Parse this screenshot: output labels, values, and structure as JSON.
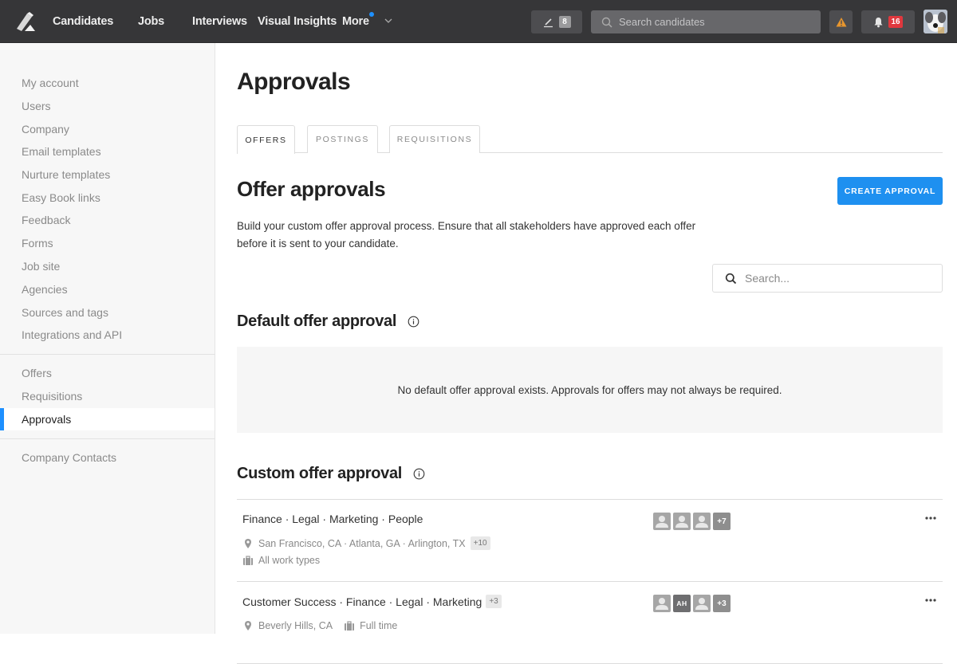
{
  "topnav": {
    "logo": "lever-logo",
    "links": [
      "Candidates",
      "Jobs",
      "Interviews",
      "Visual Insights",
      "More"
    ],
    "more_has_notification": true,
    "tasks_count": "8",
    "search_placeholder": "Search candidates",
    "notifications_count": "16",
    "colors": {
      "bar": "#363638",
      "accent": "#1e90ff",
      "alert": "#e0383e",
      "warning": "#e8962e"
    }
  },
  "sidebar": {
    "group1": [
      "My account",
      "Users",
      "Company",
      "Email templates",
      "Nurture templates",
      "Easy Book links",
      "Feedback",
      "Forms",
      "Job site",
      "Agencies",
      "Sources and tags",
      "Integrations and API"
    ],
    "group2": [
      "Offers",
      "Requisitions",
      "Approvals"
    ],
    "group3": [
      "Company Contacts"
    ],
    "active": "Approvals"
  },
  "main": {
    "title": "Approvals",
    "tabs": [
      {
        "label": "OFFERS",
        "active": true
      },
      {
        "label": "POSTINGS",
        "active": false
      },
      {
        "label": "REQUISITIONS",
        "active": false
      }
    ],
    "section_title": "Offer approvals",
    "create_button": "CREATE APPROVAL",
    "description": "Build your custom offer approval process. Ensure that all stakeholders have approved each offer before it is sent to your candidate.",
    "search_placeholder": "Search...",
    "default_title": "Default offer approval",
    "default_empty": "No default offer approval exists. Approvals for offers may not always be required.",
    "custom_title": "Custom offer approval",
    "custom_approvals": [
      {
        "teams": "Finance · Legal · Marketing · People",
        "teams_more": "",
        "locations": "San Francisco, CA · Atlanta, GA · Arlington, TX",
        "locations_more": "+10",
        "work_type": "All work types",
        "approvers": [
          "user",
          "user",
          "user"
        ],
        "approvers_more": "+7"
      },
      {
        "teams": "Customer Success · Finance · Legal · Marketing",
        "teams_more": "+3",
        "locations": "Beverly Hills, CA",
        "locations_more": "",
        "work_type": "Full time",
        "approvers": [
          "user",
          "AH",
          "user"
        ],
        "approvers_more": "+3"
      }
    ]
  }
}
